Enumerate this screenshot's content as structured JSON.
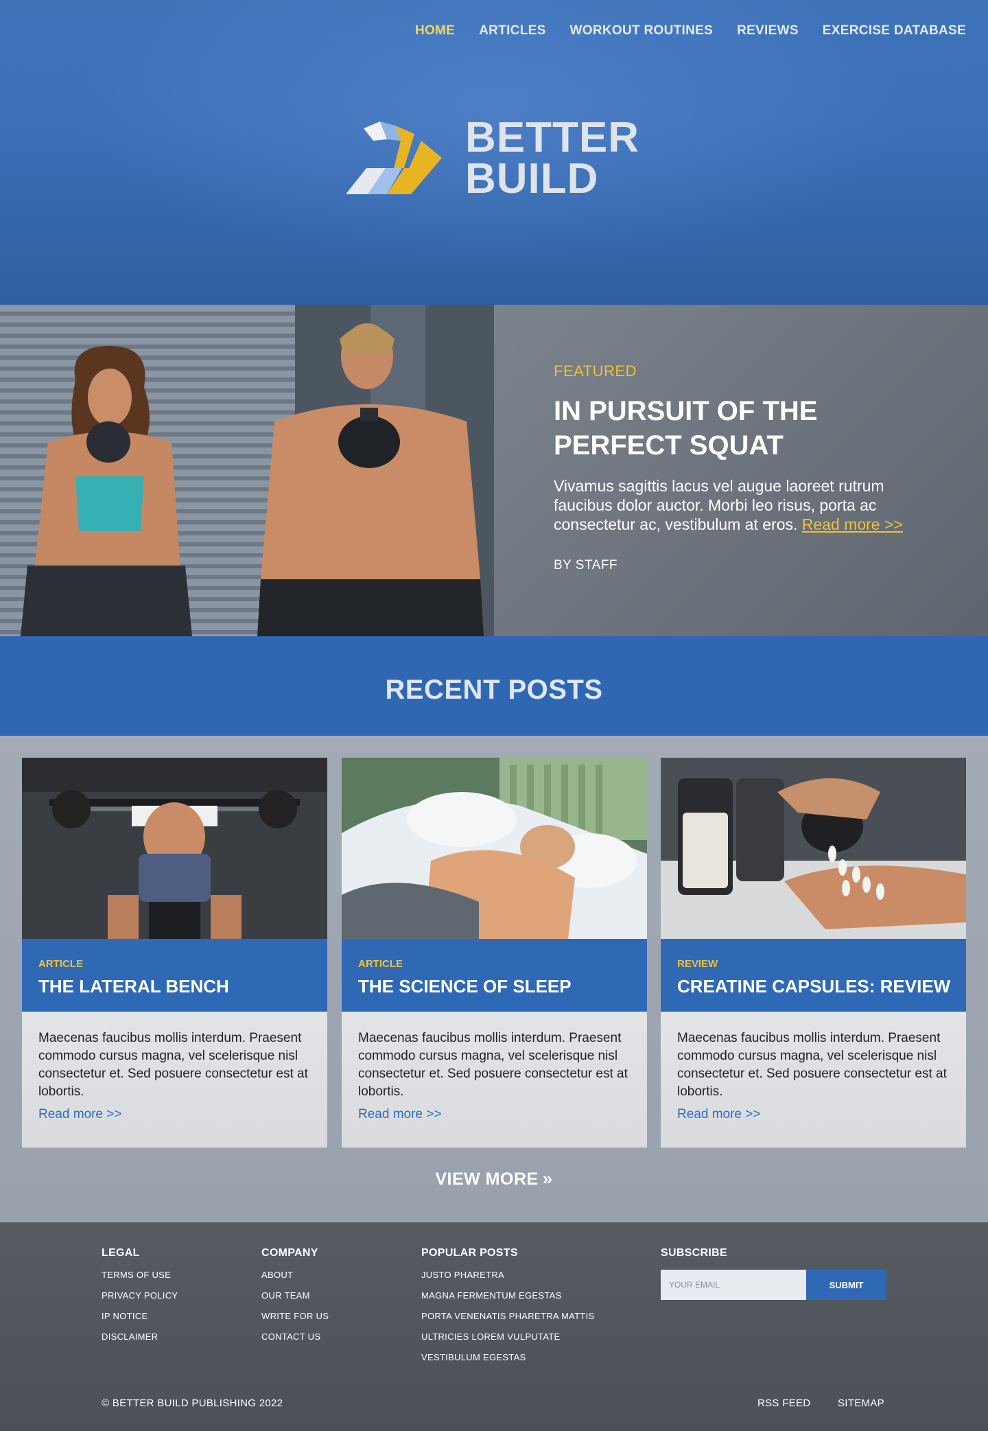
{
  "nav": {
    "items": [
      {
        "label": "HOME",
        "active": true
      },
      {
        "label": "ARTICLES"
      },
      {
        "label": "WORKOUT ROUTINES"
      },
      {
        "label": "REVIEWS"
      },
      {
        "label": "EXERCISE DATABASE"
      }
    ]
  },
  "brand": {
    "line1": "BETTER",
    "line2": "BUILD"
  },
  "featured": {
    "label": "FEATURED",
    "title": "IN PURSUIT OF THE PERFECT SQUAT",
    "description": "Vivamus sagittis lacus vel augue laoreet rutrum faucibus dolor auctor. Morbi leo risus, porta ac consectetur ac, vestibulum at eros.",
    "read_more": "Read more >>",
    "author": "BY STAFF"
  },
  "recent": {
    "title": "RECENT POSTS",
    "posts": [
      {
        "category": "ARTICLE",
        "title": "THE LATERAL BENCH",
        "excerpt": "Maecenas faucibus mollis interdum. Praesent commodo cursus magna, vel scelerisque nisl consectetur et. Sed posuere consectetur est at lobortis.",
        "read_more": "Read more >>"
      },
      {
        "category": "ARTICLE",
        "title": "THE SCIENCE OF SLEEP",
        "excerpt": "Maecenas faucibus mollis interdum. Praesent commodo cursus magna, vel scelerisque nisl consectetur et. Sed posuere consectetur est at lobortis.",
        "read_more": "Read more >>"
      },
      {
        "category": "REVIEW",
        "title": "CREATINE CAPSULES: REVIEW",
        "excerpt": "Maecenas faucibus mollis interdum. Praesent commodo cursus magna, vel scelerisque nisl consectetur et. Sed posuere consectetur est at lobortis.",
        "read_more": "Read more >>"
      }
    ],
    "view_more": "VIEW MORE"
  },
  "footer": {
    "legal": {
      "heading": "LEGAL",
      "links": [
        "TERMS OF USE",
        "PRIVACY POLICY",
        "IP NOTICE",
        "DISCLAIMER"
      ]
    },
    "company": {
      "heading": "COMPANY",
      "links": [
        "ABOUT",
        "OUR TEAM",
        "WRITE FOR US",
        "CONTACT US"
      ]
    },
    "popular": {
      "heading": "POPULAR POSTS",
      "links": [
        "JUSTO PHARETRA",
        "MAGNA FERMENTUM EGESTAS",
        "PORTA VENENATIS PHARETRA MATTIS",
        "ULTRICIES LOREM VULPUTATE",
        "VESTIBULUM EGESTAS"
      ]
    },
    "subscribe": {
      "heading": "SUBSCRIBE",
      "placeholder": "YOUR EMAIL",
      "button": "SUBMIT"
    },
    "copyright": "© BETTER BUILD PUBLISHING 2022",
    "rss": "RSS FEED",
    "sitemap": "SITEMAP"
  },
  "colors": {
    "accent_yellow": "#f2c230",
    "brand_blue": "#2f69b6",
    "nav_active": "#f4d65a"
  }
}
